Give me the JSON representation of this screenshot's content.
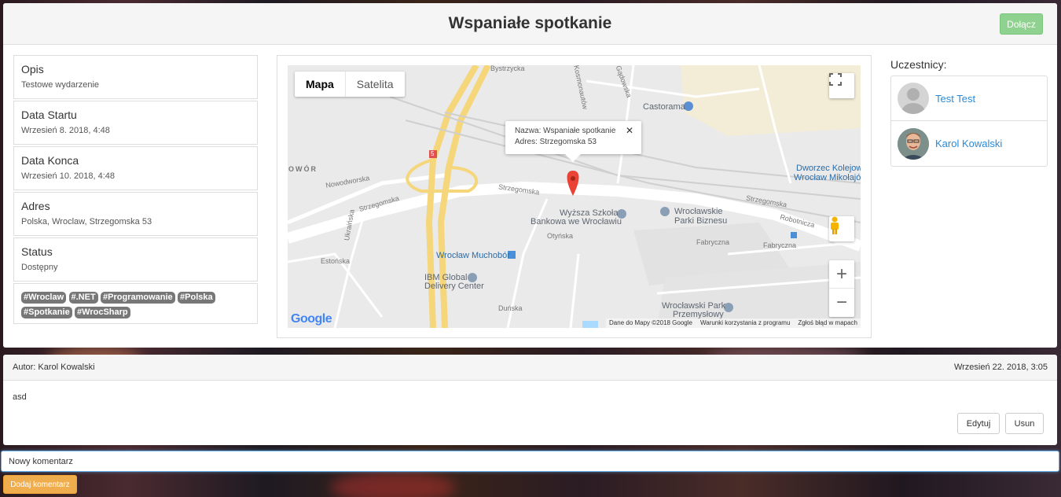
{
  "event": {
    "title": "Wspaniałe spotkanie",
    "join_label": "Dołącz"
  },
  "info": {
    "description_label": "Opis",
    "description_value": "Testowe wydarzenie",
    "start_label": "Data Startu",
    "start_value": "Wrzesień 8. 2018, 4:48",
    "end_label": "Data Konca",
    "end_value": "Wrzesień 10. 2018, 4:48",
    "address_label": "Adres",
    "address_value": "Polska, Wroclaw, Strzegomska 53",
    "status_label": "Status",
    "status_value": "Dostępny",
    "tags": [
      "#Wroclaw",
      "#.NET",
      "#Programowanie",
      "#Polska",
      "#Spotkanie",
      "#WrocSharp"
    ]
  },
  "map": {
    "type_map": "Mapa",
    "type_satellite": "Satelita",
    "infowindow_name": "Nazwa: Wspaniałe spotkanie",
    "infowindow_address": "Adres: Strzegomska 53",
    "close_glyph": "✕",
    "zoom_in": "+",
    "zoom_out": "−",
    "google": "Google",
    "footer_data": "Dane do Mapy ©2018 Google",
    "footer_terms": "Warunki korzystania z programu",
    "footer_report": "Zgłoś błąd w mapach",
    "labels": {
      "bystrzycka": "Bystrzycka",
      "kosmonautow": "Kosmonautów",
      "gadowska": "Gądowska",
      "castorama": "Castorama",
      "nowodworska": "Nowodworska",
      "strzegomska_w": "Strzegomska",
      "strzegomska_c": "Strzegomska",
      "strzegomska_e": "Strzegomska",
      "robotnicza": "Robotnicza",
      "dworzec": "Dworzec Kolejowy",
      "dworzec2": "Wrocław Mikołajów",
      "wsb": "Wyższa Szkoła",
      "wsb2": "Bankowa we Wrocławiu",
      "parki": "Wrocławskie",
      "parki2": "Parki Biznesu",
      "muchobor": "Wrocław Muchobór",
      "ibm": "IBM Global",
      "ibm2": "Delivery Center",
      "park_przem": "Wrocławski Park",
      "park_przem2": "Przemysłowy",
      "owor": "OWÓR",
      "fabryczna": "Fabryczna",
      "fabryczna2": "Fabryczna",
      "otynska": "Otyńska",
      "estonska": "Estońska",
      "ukrainska": "Ukraińska",
      "dunska": "Duńska",
      "route": "5"
    }
  },
  "participants": {
    "title": "Uczestnicy:",
    "items": [
      {
        "name": "Test Test"
      },
      {
        "name": "Karol Kowalski"
      }
    ]
  },
  "comment": {
    "author": "Autor: Karol Kowalski",
    "date": "Wrzesień 22. 2018, 3:05",
    "body": "asd",
    "edit_label": "Edytuj",
    "delete_label": "Usun"
  },
  "new_comment": {
    "value": "Nowy komentarz",
    "submit_label": "Dodaj komentarz"
  },
  "colors": {
    "join": "#8fd18f",
    "tag": "#777777",
    "link": "#2b8ad6",
    "submit": "#f0ad4e",
    "marker": "#ea4335"
  }
}
